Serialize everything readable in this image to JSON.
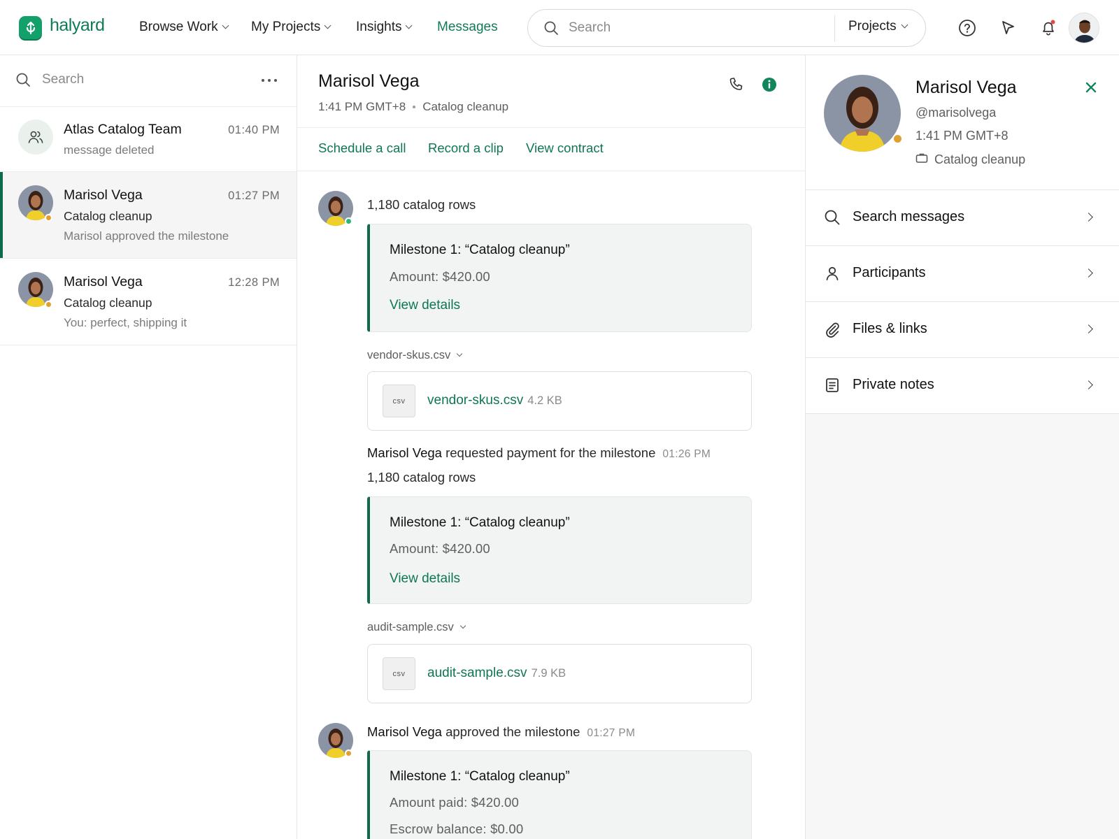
{
  "brand": {
    "name": "halyard",
    "color": "#14a06b"
  },
  "nav": {
    "items": [
      {
        "label": "Browse Work",
        "has_menu": true
      },
      {
        "label": "My Projects",
        "has_menu": true
      },
      {
        "label": "Insights",
        "has_menu": true
      },
      {
        "label": "Messages",
        "has_menu": false,
        "active": true
      }
    ]
  },
  "top_search": {
    "placeholder": "Search",
    "scope": "Projects"
  },
  "top_icons": [
    "help-icon",
    "cursor-icon",
    "bell-icon"
  ],
  "sidebar": {
    "search_placeholder": "Search",
    "conversations": [
      {
        "name": "Atlas Catalog Team",
        "time": "01:40 PM",
        "preview": "message deleted",
        "type": "group"
      },
      {
        "name": "Marisol Vega",
        "time": "01:27 PM",
        "project": "Catalog cleanup",
        "preview": "Marisol approved the milestone",
        "selected": true,
        "status": "away"
      },
      {
        "name": "Marisol Vega",
        "time": "12:28 PM",
        "project": "Catalog cleanup",
        "preview": "You: perfect, shipping it",
        "status": "away"
      }
    ]
  },
  "chat": {
    "name": "Marisol Vega",
    "local_time": "1:41 PM GMT+8",
    "project": "Catalog cleanup",
    "actions": [
      "Schedule a call",
      "Record a clip",
      "View contract"
    ],
    "messages": {
      "m1_text": "1,180 catalog rows",
      "m1_card": {
        "title": "Milestone 1: “Catalog cleanup”",
        "amount": "Amount: $420.00",
        "link": "View details"
      },
      "file1": {
        "label": "vendor-skus.csv",
        "type": "csv",
        "name": "vendor-skus.csv",
        "size": "4.2 KB"
      },
      "m2_author": "Marisol Vega",
      "m2_action": "requested payment for the milestone",
      "m2_time": "01:26 PM",
      "m2_text": "1,180 catalog rows",
      "m2_card": {
        "title": "Milestone 1: “Catalog cleanup”",
        "amount": "Amount: $420.00",
        "link": "View details"
      },
      "file2": {
        "label": "audit-sample.csv",
        "type": "csv",
        "name": "audit-sample.csv",
        "size": "7.9 KB"
      },
      "m3_author": "Marisol Vega",
      "m3_action": "approved the milestone",
      "m3_time": "01:27 PM",
      "m3_card": {
        "title": "Milestone 1: “Catalog cleanup”",
        "amount_paid": "Amount paid: $420.00",
        "escrow": "Escrow balance: $0.00"
      }
    }
  },
  "profile": {
    "name": "Marisol Vega",
    "handle": "@marisolvega",
    "local_time": "1:41 PM GMT+8",
    "project": "Catalog cleanup",
    "menu": [
      {
        "label": "Search messages",
        "icon": "search-icon"
      },
      {
        "label": "Participants",
        "icon": "person-icon"
      },
      {
        "label": "Files & links",
        "icon": "paperclip-icon"
      },
      {
        "label": "Private notes",
        "icon": "notes-icon"
      }
    ]
  },
  "colors": {
    "accent": "#0f7653",
    "online": "#2bb673",
    "away": "#e0a030"
  }
}
